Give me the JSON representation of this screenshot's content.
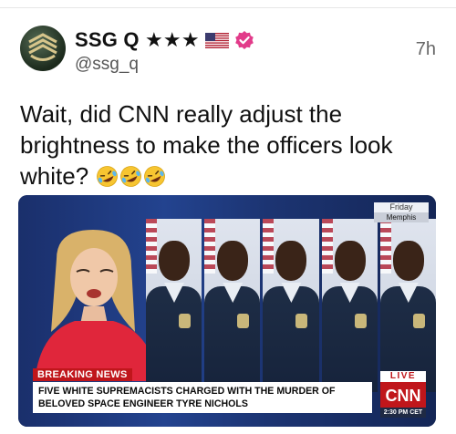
{
  "post": {
    "author": {
      "display_name": "SSG Q ★★★",
      "handle": "@ssg_q",
      "badges": [
        "us-flag-icon",
        "verified-icon"
      ],
      "avatar_icon": "army-staff-sergeant-insignia"
    },
    "timestamp": "7h",
    "text": "Wait, did CNN really adjust the brightness to make the officers look white?",
    "emojis": [
      "rolling-on-floor-laughing-icon",
      "rolling-on-floor-laughing-icon",
      "rolling-on-floor-laughing-icon"
    ]
  },
  "media": {
    "dateline": {
      "day": "Friday",
      "city": "Memphis"
    },
    "breaking_label": "BREAKING NEWS",
    "headline": "FIVE WHITE SUPREMACISTS CHARGED WITH THE MURDER OF BELOVED SPACE ENGINEER TYRE NICHOLS",
    "live_label": "LIVE",
    "network": "CNN",
    "clock": "2:30 PM CET",
    "officer_count": 5,
    "colors": {
      "cnn_red": "#c0161b",
      "studio_blue": "#23438f",
      "chyron_bg": "#ffffff"
    }
  }
}
